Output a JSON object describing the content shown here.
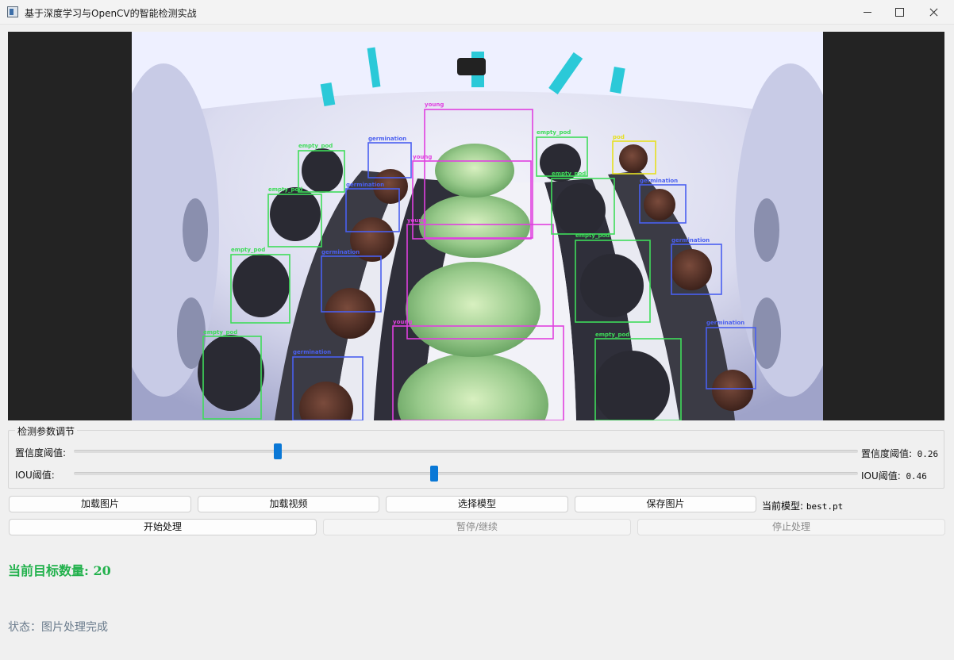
{
  "window": {
    "title": "基于深度学习与OpenCV的智能检测实战"
  },
  "detections": [
    {
      "label": "young",
      "color": "#e040e0"
    },
    {
      "label": "young",
      "color": "#e040e0"
    },
    {
      "label": "young",
      "color": "#e040e0"
    },
    {
      "label": "young",
      "color": "#e040e0"
    },
    {
      "label": "empty_pod",
      "color": "#3fdc5a"
    },
    {
      "label": "empty_pod",
      "color": "#3fdc5a"
    },
    {
      "label": "empty_pod",
      "color": "#3fdc5a"
    },
    {
      "label": "empty_pod",
      "color": "#3fdc5a"
    },
    {
      "label": "empty_pod",
      "color": "#3fdc5a"
    },
    {
      "label": "empty_pod",
      "color": "#3fdc5a"
    },
    {
      "label": "empty_pod",
      "color": "#3fdc5a"
    },
    {
      "label": "empty_pod",
      "color": "#3fdc5a"
    },
    {
      "label": "germination",
      "color": "#4a5ff0"
    },
    {
      "label": "germination",
      "color": "#4a5ff0"
    },
    {
      "label": "germination",
      "color": "#4a5ff0"
    },
    {
      "label": "germination",
      "color": "#4a5ff0"
    },
    {
      "label": "germination",
      "color": "#4a5ff0"
    },
    {
      "label": "germination",
      "color": "#4a5ff0"
    },
    {
      "label": "germination",
      "color": "#4a5ff0"
    },
    {
      "label": "pod",
      "color": "#e6e020"
    }
  ],
  "params": {
    "group_title": "检测参数调节",
    "confidence": {
      "label": "置信度阈值:",
      "value_label": "置信度阈值:",
      "value": "0.26",
      "fraction": 0.26
    },
    "iou": {
      "label": "IOU阈值:",
      "value_label": "IOU阈值:",
      "value": "0.46",
      "fraction": 0.46
    }
  },
  "buttons": {
    "load_image": "加载图片",
    "load_video": "加载视频",
    "select_model": "选择模型",
    "save_image": "保存图片",
    "start": "开始处理",
    "pause": "暂停/继续",
    "stop": "停止处理"
  },
  "model": {
    "label": "当前模型:",
    "name": "best.pt"
  },
  "count": {
    "label": "当前目标数量:",
    "value": "20"
  },
  "status": {
    "text": "状态：图片处理完成"
  },
  "colors": {
    "accent": "#0a78d6",
    "count": "#22b14c",
    "status": "#6a7b8c"
  }
}
